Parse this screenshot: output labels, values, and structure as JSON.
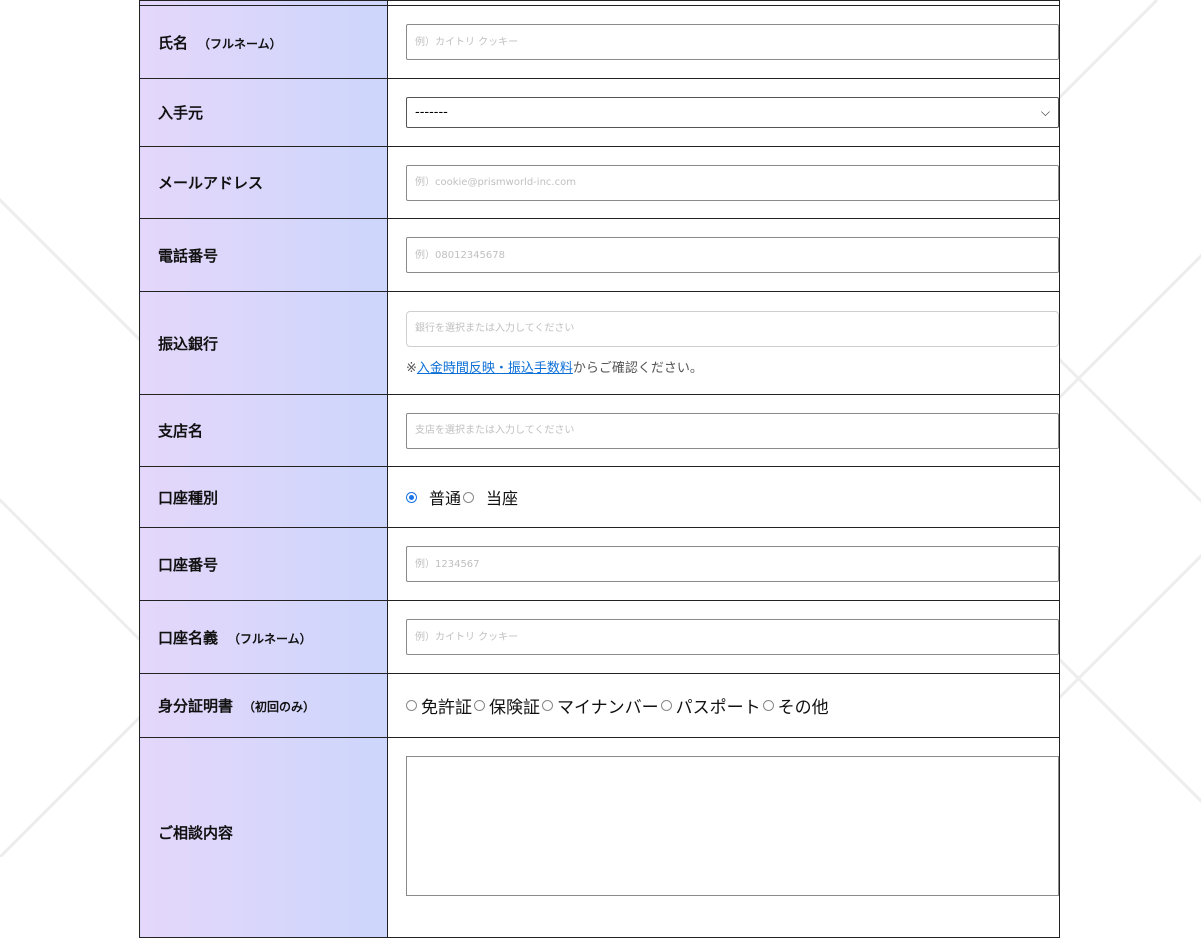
{
  "form": {
    "rows": {
      "name": {
        "label": "氏名",
        "sub": "（フルネーム）",
        "placeholder": "例）カイトリ クッキー"
      },
      "source": {
        "label": "入手元",
        "selected": "-------"
      },
      "email": {
        "label": "メールアドレス",
        "placeholder": "例）cookie@prismworld-inc.com"
      },
      "phone": {
        "label": "電話番号",
        "placeholder": "例）08012345678"
      },
      "bank": {
        "label": "振込銀行",
        "placeholder": "銀行を選択または入力してください",
        "note_prefix": "※",
        "note_link": "入金時間反映・振込手数料",
        "note_suffix": "からご確認ください。"
      },
      "branch": {
        "label": "支店名",
        "placeholder": "支店を選択または入力してください"
      },
      "account_type": {
        "label": "口座種別",
        "options": [
          "普通",
          "当座"
        ],
        "selected": "普通"
      },
      "account_number": {
        "label": "口座番号",
        "placeholder": "例）1234567"
      },
      "account_holder": {
        "label": "口座名義",
        "sub": "（フルネーム）",
        "placeholder": "例）カイトリ クッキー"
      },
      "id_doc": {
        "label": "身分証明書",
        "sub": "（初回のみ）",
        "options": [
          "免許証",
          "保険証",
          "マイナンバー",
          "パスポート",
          "その他"
        ]
      },
      "consultation": {
        "label": "ご相談内容"
      }
    }
  },
  "colors": {
    "label_gradient_start": "#e4d7fb",
    "label_gradient_end": "#cdd6fb",
    "link": "#0b6fd6",
    "radio_accent": "#1a73e8"
  }
}
